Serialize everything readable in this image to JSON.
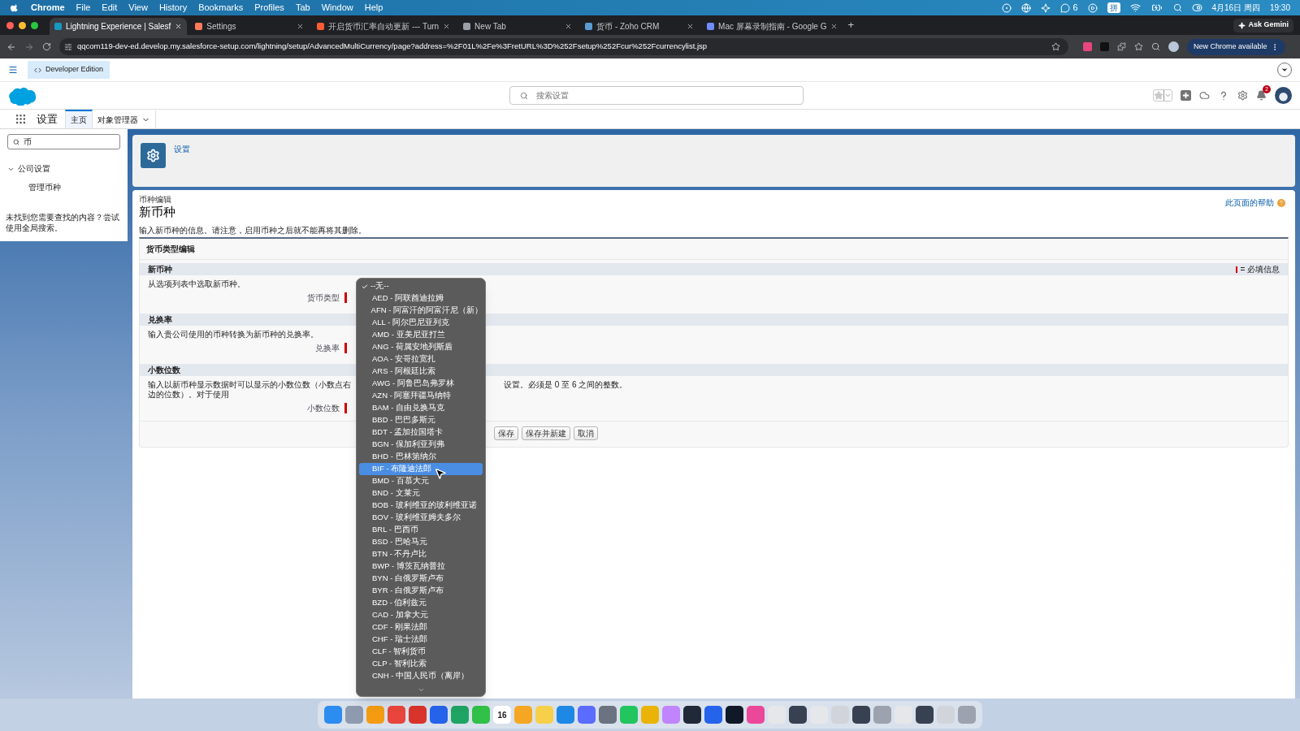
{
  "menu_bar": {
    "app": "Chrome",
    "menus": [
      "File",
      "Edit",
      "View",
      "History",
      "Bookmarks",
      "Profiles",
      "Tab",
      "Window",
      "Help"
    ],
    "wechat_count": "6",
    "input_method": "拼",
    "date": "4月16日 周四",
    "time": "19:30"
  },
  "browser": {
    "tabs": [
      {
        "title": "Lightning Experience | Salesf",
        "selected": true
      },
      {
        "title": "Settings",
        "selected": false
      },
      {
        "title": "开启货币汇率自动更新 --- Turn",
        "selected": false
      },
      {
        "title": "New Tab",
        "selected": false
      },
      {
        "title": "货币 - Zoho CRM",
        "selected": false
      },
      {
        "title": "Mac 屏幕录制指南 - Google G",
        "selected": false
      }
    ],
    "new_tab": "+",
    "ask_gemini": "Ask Gemini",
    "url": "qqcom119-dev-ed.develop.my.salesforce-setup.com/lightning/setup/AdvancedMultiCurrency/page?address=%2F01L%2Fe%3FretURL%3D%252Fsetup%252Fcur%252Fcurrencylist.jsp",
    "update_button": "New Chrome available"
  },
  "edition_badge": "Developer Edition",
  "header": {
    "search_placeholder": "搜索设置",
    "notification_count": "2"
  },
  "nav": {
    "app_name": "设置",
    "tabs": [
      {
        "label": "主页",
        "selected": true,
        "dropdown": false
      },
      {
        "label": "对象管理器",
        "selected": false,
        "dropdown": true
      }
    ]
  },
  "sidebar": {
    "search_value": "币",
    "tree": [
      {
        "label": "公司设置",
        "expanded": true,
        "children": [
          {
            "label": "管理币种"
          }
        ]
      }
    ],
    "no_result_hint": "未找到您需要查找的内容？尝试使用全局搜索。"
  },
  "breadcrumb": "设置",
  "page": {
    "subtitle": "币种编辑",
    "title": "新币种",
    "help_link": "此页面的帮助",
    "intro": "输入新币种的信息。请注意，启用币种之后就不能再将其删除。",
    "panel_title": "货币类型编辑",
    "required_legend": "= 必填信息",
    "sections": [
      {
        "heading": "新币种",
        "description": "从选项列表中选取新币种。",
        "field_label": "货币类型"
      },
      {
        "heading": "兑换率",
        "description": "输入贵公司使用的币种转换为新币种的兑换率。",
        "field_label": "兑换率"
      },
      {
        "heading": "小数位数",
        "description": "输入以新币种显示数据时可以显示的小数位数（小数点右边的位数）。对于使用",
        "description_after": "设置。必须是 0 至 6 之间的整数。",
        "field_label": "小数位数"
      }
    ],
    "buttons": [
      "保存",
      "保存并新建",
      "取消"
    ]
  },
  "dropdown": {
    "options": [
      {
        "label": "--无--",
        "checked": true,
        "highlighted": false
      },
      {
        "label": "AED - 阿联酋迪拉姆",
        "checked": false,
        "highlighted": false
      },
      {
        "label": "AFN - 阿富汗的阿富汗尼（新）",
        "checked": false,
        "highlighted": false
      },
      {
        "label": "ALL - 阿尔巴尼亚列克",
        "checked": false,
        "highlighted": false
      },
      {
        "label": "AMD - 亚美尼亚打兰",
        "checked": false,
        "highlighted": false
      },
      {
        "label": "ANG - 荷属安地列斯盾",
        "checked": false,
        "highlighted": false
      },
      {
        "label": "AOA - 安哥拉宽扎",
        "checked": false,
        "highlighted": false
      },
      {
        "label": "ARS - 阿根廷比索",
        "checked": false,
        "highlighted": false
      },
      {
        "label": "AWG - 阿鲁巴岛弗罗林",
        "checked": false,
        "highlighted": false
      },
      {
        "label": "AZN - 阿塞拜疆马纳特",
        "checked": false,
        "highlighted": false
      },
      {
        "label": "BAM - 自由兑换马克",
        "checked": false,
        "highlighted": false
      },
      {
        "label": "BBD - 巴巴多斯元",
        "checked": false,
        "highlighted": false
      },
      {
        "label": "BDT - 孟加拉国塔卡",
        "checked": false,
        "highlighted": false
      },
      {
        "label": "BGN - 保加利亚列弗",
        "checked": false,
        "highlighted": false
      },
      {
        "label": "BHD - 巴林第纳尔",
        "checked": false,
        "highlighted": false
      },
      {
        "label": "BIF - 布隆迪法郎",
        "checked": false,
        "highlighted": true
      },
      {
        "label": "BMD - 百慕大元",
        "checked": false,
        "highlighted": false
      },
      {
        "label": "BND - 文莱元",
        "checked": false,
        "highlighted": false
      },
      {
        "label": "BOB - 玻利维亚的玻利维亚诺",
        "checked": false,
        "highlighted": false
      },
      {
        "label": "BOV - 玻利维亚姆夫多尔",
        "checked": false,
        "highlighted": false
      },
      {
        "label": "BRL - 巴西币",
        "checked": false,
        "highlighted": false
      },
      {
        "label": "BSD - 巴哈马元",
        "checked": false,
        "highlighted": false
      },
      {
        "label": "BTN - 不丹卢比",
        "checked": false,
        "highlighted": false
      },
      {
        "label": "BWP - 博茨瓦纳普拉",
        "checked": false,
        "highlighted": false
      },
      {
        "label": "BYN - 白俄罗斯卢布",
        "checked": false,
        "highlighted": false
      },
      {
        "label": "BYR - 白俄罗斯卢布",
        "checked": false,
        "highlighted": false
      },
      {
        "label": "BZD - 伯利兹元",
        "checked": false,
        "highlighted": false
      },
      {
        "label": "CAD - 加拿大元",
        "checked": false,
        "highlighted": false
      },
      {
        "label": "CDF - 刚果法郎",
        "checked": false,
        "highlighted": false
      },
      {
        "label": "CHF - 瑞士法郎",
        "checked": false,
        "highlighted": false
      },
      {
        "label": "CLF - 智利货币",
        "checked": false,
        "highlighted": false
      },
      {
        "label": "CLP - 智利比索",
        "checked": false,
        "highlighted": false
      },
      {
        "label": "CNH - 中国人民币（离岸）",
        "checked": false,
        "highlighted": false
      }
    ]
  },
  "dock": {
    "calendar_day": "16"
  }
}
